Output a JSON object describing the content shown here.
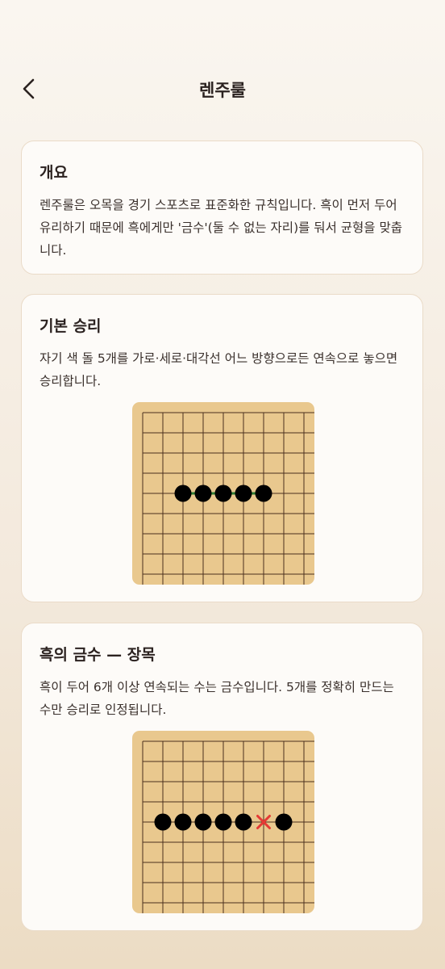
{
  "header": {
    "title": "렌주룰"
  },
  "cards": [
    {
      "title": "개요",
      "body": "렌주룰은 오목을 경기 스포츠로 표준화한 규칙입니다. 흑이 먼저 두어 유리하기 때문에 흑에게만 '금수'(둘 수 없는 자리)를 둬서 균형을 맞춥니다."
    },
    {
      "title": "기본 승리",
      "body": "자기 색 돌 5개를 가로·세로·대각선 어느 방향으로든 연속으로 놓으면 승리합니다.",
      "diagram": {
        "grid_lines": 9,
        "black_stones": [
          [
            4,
            2
          ],
          [
            4,
            3
          ],
          [
            4,
            4
          ],
          [
            4,
            5
          ],
          [
            4,
            6
          ]
        ],
        "highlight_line": {
          "row": 4,
          "from_col": 2,
          "to_col": 6,
          "color": "#2e7d32"
        }
      }
    },
    {
      "title": "흑의 금수 — 장목",
      "body": "흑이 두어 6개 이상 연속되는 수는 금수입니다. 5개를 정확히 만드는 수만 승리로 인정됩니다.",
      "diagram": {
        "grid_lines": 9,
        "black_stones": [
          [
            4,
            1
          ],
          [
            4,
            2
          ],
          [
            4,
            3
          ],
          [
            4,
            4
          ],
          [
            4,
            5
          ],
          [
            4,
            7
          ]
        ],
        "forbidden_mark": [
          4,
          6
        ],
        "mark_color": "#e53935"
      }
    }
  ],
  "colors": {
    "board": "#e9c88e",
    "line": "#4a2f1d",
    "stone": "#000000"
  }
}
